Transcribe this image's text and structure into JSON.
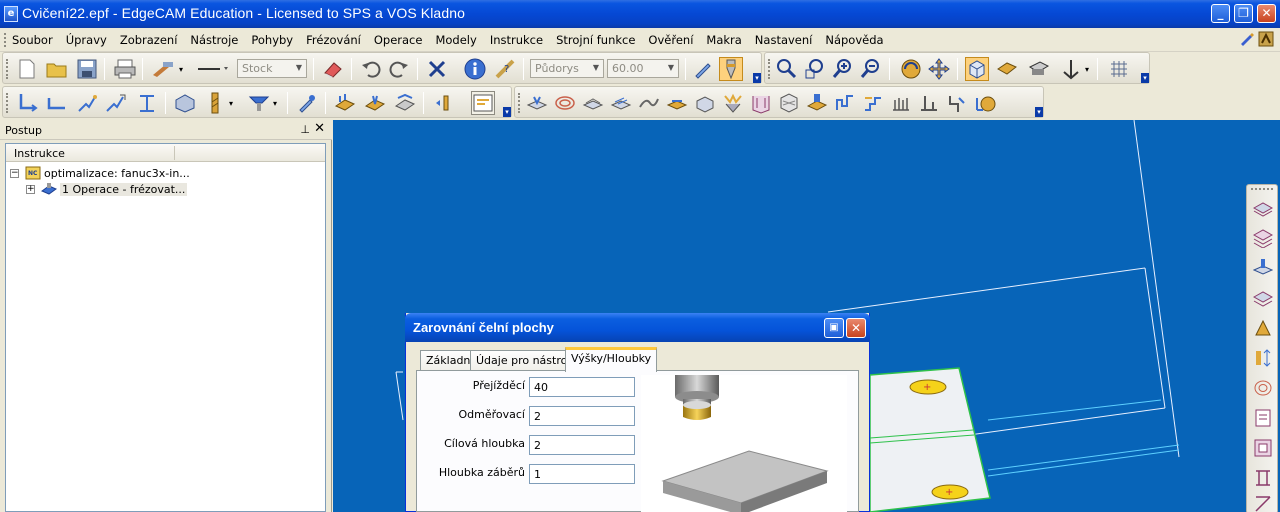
{
  "window": {
    "title": "Cvičení22.epf - EdgeCAM Education - Licensed to SPS a VOS Kladno"
  },
  "menu": {
    "items": [
      "Soubor",
      "Úpravy",
      "Zobrazení",
      "Nástroje",
      "Pohyby",
      "Frézování",
      "Operace",
      "Modely",
      "Instrukce",
      "Strojní funkce",
      "Ověření",
      "Makra",
      "Nastavení",
      "Nápověda"
    ]
  },
  "toolbar1": {
    "stock_combo": "Stock",
    "view_combo": "Půdorys",
    "value_combo": "60.00"
  },
  "panel": {
    "title": "Postup",
    "pin": "⊥",
    "close": "✕",
    "column_header": "Instrukce",
    "tree": [
      {
        "label": "optimalizace: fanuc3x-in...",
        "expander": "−"
      },
      {
        "label": "1 Operace - frézovat...",
        "expander": "+"
      }
    ]
  },
  "dialog": {
    "title": "Zarovnání čelní plochy",
    "tabs": [
      "Základní",
      "Údaje pro nástroj",
      "Výšky/Hloubky"
    ],
    "active_tab": "Výšky/Hloubky",
    "fields": [
      {
        "label": "Přejížděcí",
        "value": "40"
      },
      {
        "label": "Odměřovací",
        "value": "2"
      },
      {
        "label": "Cílová hloubka",
        "value": "2"
      },
      {
        "label": "Hloubka záběrů",
        "value": "1"
      }
    ]
  },
  "colors": {
    "viewport_bg": "#0764b8",
    "titlebar": "#0548d4",
    "wireframe": "#e8f0ff",
    "model_edge": "#2ec14a",
    "hole_fill": "#f5d21a"
  }
}
